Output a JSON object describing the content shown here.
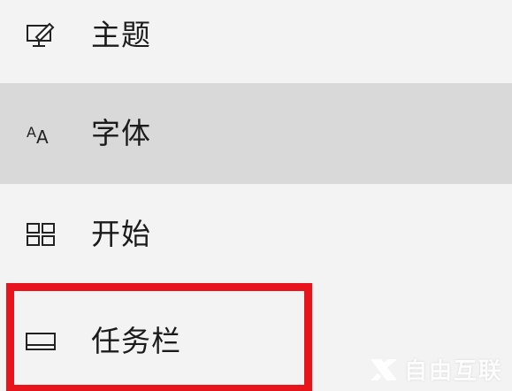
{
  "nav": {
    "items": [
      {
        "label": "主题",
        "icon": "theme-icon"
      },
      {
        "label": "字体",
        "icon": "fonts-icon",
        "selected": true
      },
      {
        "label": "开始",
        "icon": "start-icon"
      },
      {
        "label": "任务栏",
        "icon": "taskbar-icon"
      }
    ]
  },
  "annotation": {
    "color": "#e8141b"
  },
  "watermark": {
    "text": "自由互联",
    "icon": "x-logo-icon"
  }
}
